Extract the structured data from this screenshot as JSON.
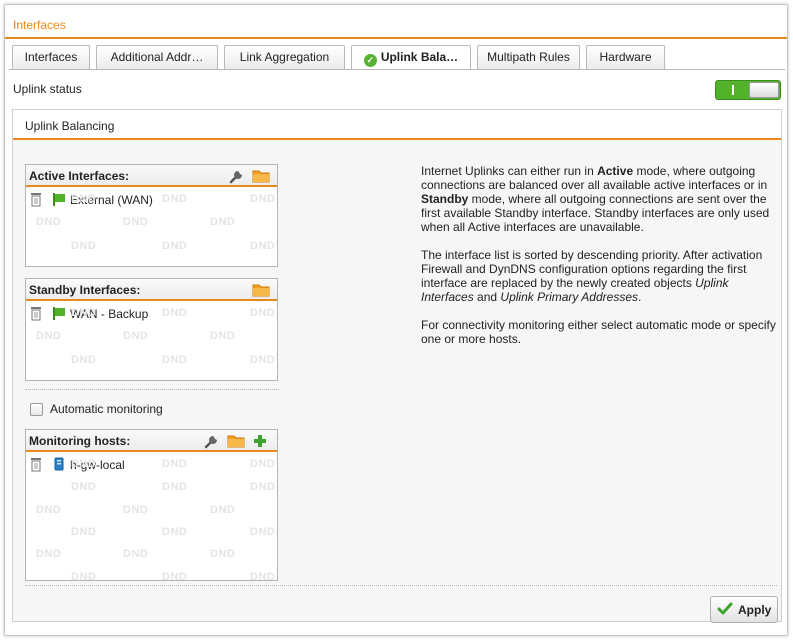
{
  "window": {
    "title": "Interfaces"
  },
  "tabs": [
    {
      "label": "Interfaces",
      "active": false
    },
    {
      "label": "Additional Addr…",
      "active": false
    },
    {
      "label": "Link Aggregation",
      "active": false
    },
    {
      "label": "Uplink Bala…",
      "active": true
    },
    {
      "label": "Multipath Rules",
      "active": false
    },
    {
      "label": "Hardware",
      "active": false
    }
  ],
  "uplink_status": {
    "label": "Uplink status",
    "enabled": true
  },
  "panel": {
    "title": "Uplink Balancing"
  },
  "active_interfaces": {
    "label": "Active Interfaces:",
    "items": [
      {
        "label": "External (WAN)",
        "icon": "interface-flag-icon"
      }
    ]
  },
  "standby_interfaces": {
    "label": "Standby Interfaces:",
    "items": [
      {
        "label": "WAN - Backup",
        "icon": "interface-flag-icon"
      }
    ]
  },
  "automatic_monitoring": {
    "label": "Automatic monitoring",
    "checked": false
  },
  "monitoring_hosts": {
    "label": "Monitoring hosts:",
    "items": [
      {
        "label": "h-gw-local",
        "icon": "host-icon"
      }
    ]
  },
  "dnd_text": "DND",
  "description": {
    "p1_part1": "Internet Uplinks can either run in ",
    "p1_bold1": "Active",
    "p1_part2": " mode, where outgoing connections are balanced over all available active interfaces or in ",
    "p1_bold2": "Standby",
    "p1_part3": " mode, where all outgoing connections are sent over the first available Standby interface. Standby interfaces are only used when all Active interfaces are unavailable.",
    "p2_part1": "The interface list is sorted by descending priority. After activation Firewall and DynDNS configuration options regarding the first interface are replaced by the newly created objects ",
    "p2_italic1": "Uplink Interfaces",
    "p2_part2": " and ",
    "p2_italic2": "Uplink Primary Addresses",
    "p2_part3": ".",
    "p3": "For connectivity monitoring either select automatic mode or specify one or more hosts."
  },
  "apply_button": {
    "label": "Apply"
  },
  "colors": {
    "accent": "#e8891e",
    "toggle_on": "#52b32b",
    "check_green": "#57b233"
  }
}
